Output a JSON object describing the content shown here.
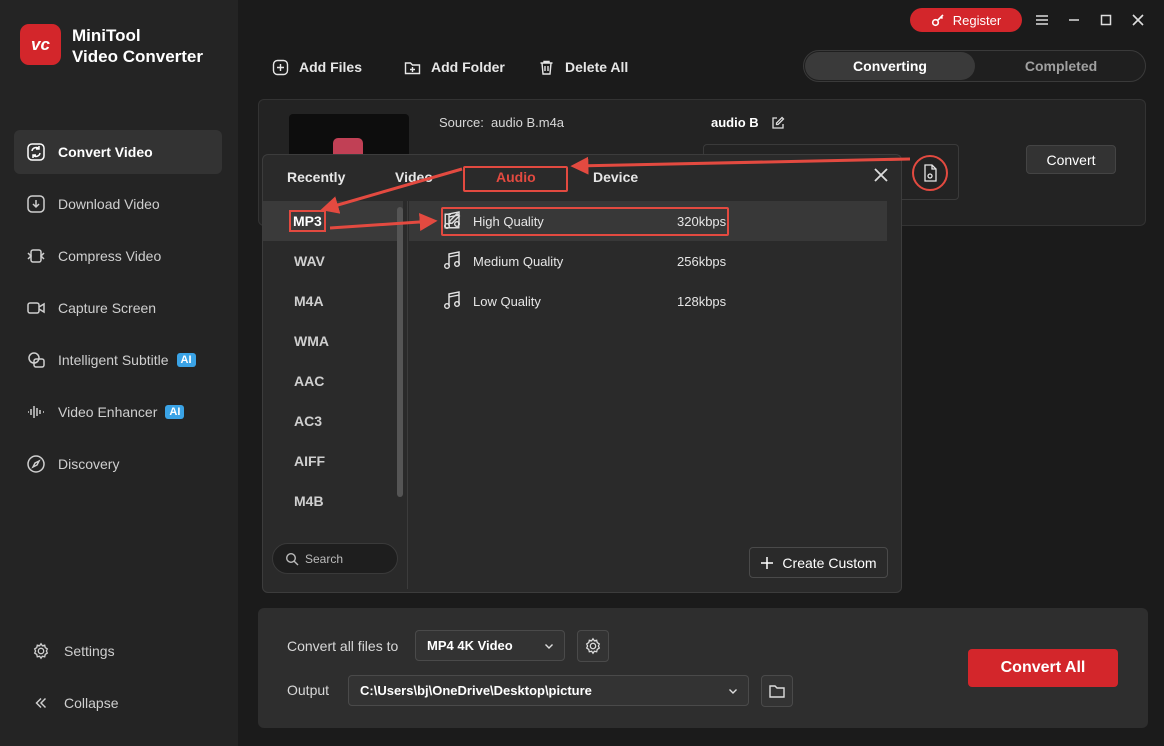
{
  "app": {
    "logo_text": "vc",
    "title_line1": "MiniTool",
    "title_line2": "Video Converter"
  },
  "sidebar": {
    "items": [
      {
        "label": "Convert Video",
        "icon": "convert-icon",
        "active": true
      },
      {
        "label": "Download Video",
        "icon": "download-icon"
      },
      {
        "label": "Compress Video",
        "icon": "compress-icon"
      },
      {
        "label": "Capture Screen",
        "icon": "camera-icon"
      },
      {
        "label": "Intelligent Subtitle",
        "icon": "subtitle-icon",
        "badge": "AI"
      },
      {
        "label": "Video Enhancer",
        "icon": "enhancer-icon",
        "badge": "AI"
      },
      {
        "label": "Discovery",
        "icon": "compass-icon"
      }
    ],
    "settings_label": "Settings",
    "collapse_label": "Collapse"
  },
  "titlebar": {
    "register_label": "Register"
  },
  "toolbar": {
    "add_files": "Add Files",
    "add_folder": "Add Folder",
    "delete_all": "Delete All",
    "tab_converting": "Converting",
    "tab_completed": "Completed"
  },
  "file": {
    "source_label": "Source:",
    "source_name": "audio B.m4a",
    "output_name": "audio B",
    "convert_label": "Convert"
  },
  "popup": {
    "tabs": [
      "Recently",
      "Video",
      "Audio",
      "Device"
    ],
    "active_tab": "Audio",
    "formats": [
      "MP3",
      "WAV",
      "M4A",
      "WMA",
      "AAC",
      "AC3",
      "AIFF",
      "M4B"
    ],
    "active_format": "MP3",
    "qualities": [
      {
        "name": "High Quality",
        "rate": "320kbps"
      },
      {
        "name": "Medium Quality",
        "rate": "256kbps"
      },
      {
        "name": "Low Quality",
        "rate": "128kbps"
      }
    ],
    "search_placeholder": "Search",
    "create_custom": "Create Custom"
  },
  "bottom": {
    "convert_all_to_label": "Convert all files to",
    "convert_all_to_value": "MP4 4K Video",
    "output_label": "Output",
    "output_path": "C:\\Users\\bj\\OneDrive\\Desktop\\picture",
    "convert_all": "Convert All"
  },
  "colors": {
    "accent": "#d3262b",
    "annotation": "#e34a40"
  }
}
